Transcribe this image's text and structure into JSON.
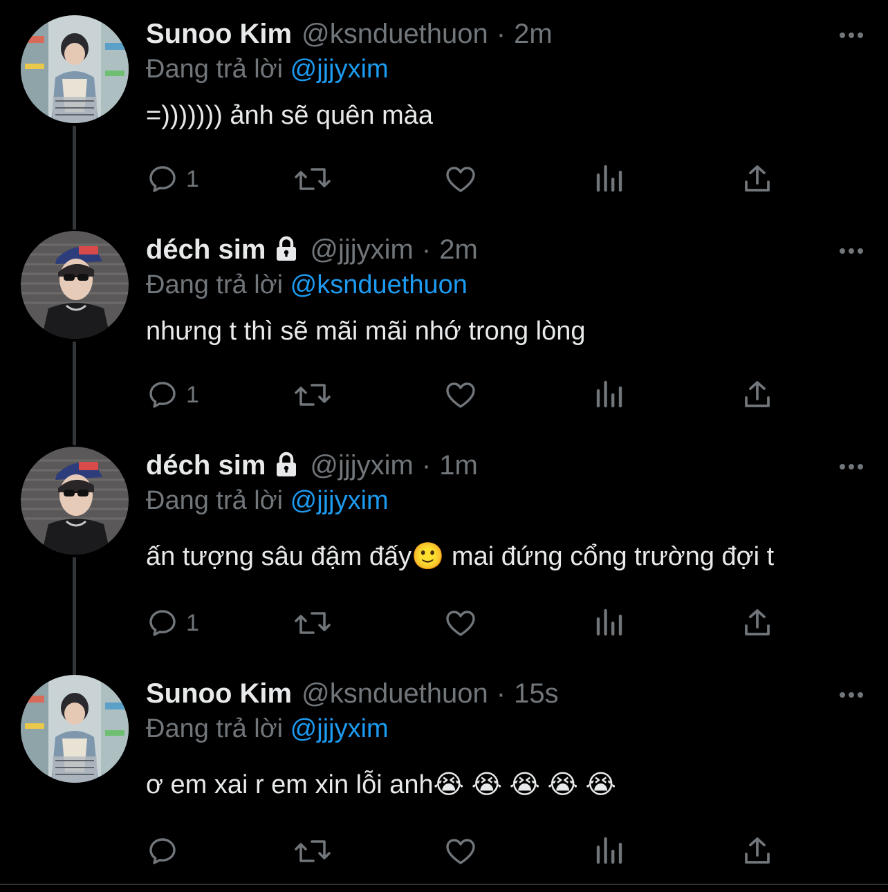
{
  "reply_prefix": "Đang trả lời",
  "colors": {
    "background": "#000000",
    "text": "#e7e9ea",
    "secondary": "#71767b",
    "mention": "#1d9bf0",
    "thread_line": "#333639"
  },
  "tweets": [
    {
      "name": "Sunoo Kim",
      "handle": "@ksnduethuon",
      "separator": "·",
      "time": "2m",
      "reply_to": "@jjjyxim",
      "text": "=))))))) ảnh sẽ quên màa",
      "reply_count": "1",
      "protected": false
    },
    {
      "name": "déch sim",
      "handle": "@jjjyxim",
      "separator": "·",
      "time": "2m",
      "reply_to": "@ksnduethuon",
      "text": "nhưng t thì sẽ mãi mãi nhớ trong lòng",
      "reply_count": "1",
      "protected": true
    },
    {
      "name": "déch sim",
      "handle": "@jjjyxim",
      "separator": "·",
      "time": "1m",
      "reply_to": "@jjjyxim",
      "text": "ấn tượng sâu đậm đấy🙂 mai đứng cổng trường đợi t",
      "reply_count": "1",
      "protected": true
    },
    {
      "name": "Sunoo Kim",
      "handle": "@ksnduethuon",
      "separator": "·",
      "time": "15s",
      "reply_to": "@jjjyxim",
      "text": "ơ em xai r em xin lỗi anh😭 😭 😭 😭 😭",
      "reply_count": "",
      "protected": false
    }
  ],
  "icons": {
    "reply": "reply-icon",
    "retweet": "retweet-icon",
    "like": "heart-icon",
    "views": "analytics-icon",
    "share": "share-icon",
    "more": "more-dots-icon",
    "protected": "lock-icon"
  }
}
